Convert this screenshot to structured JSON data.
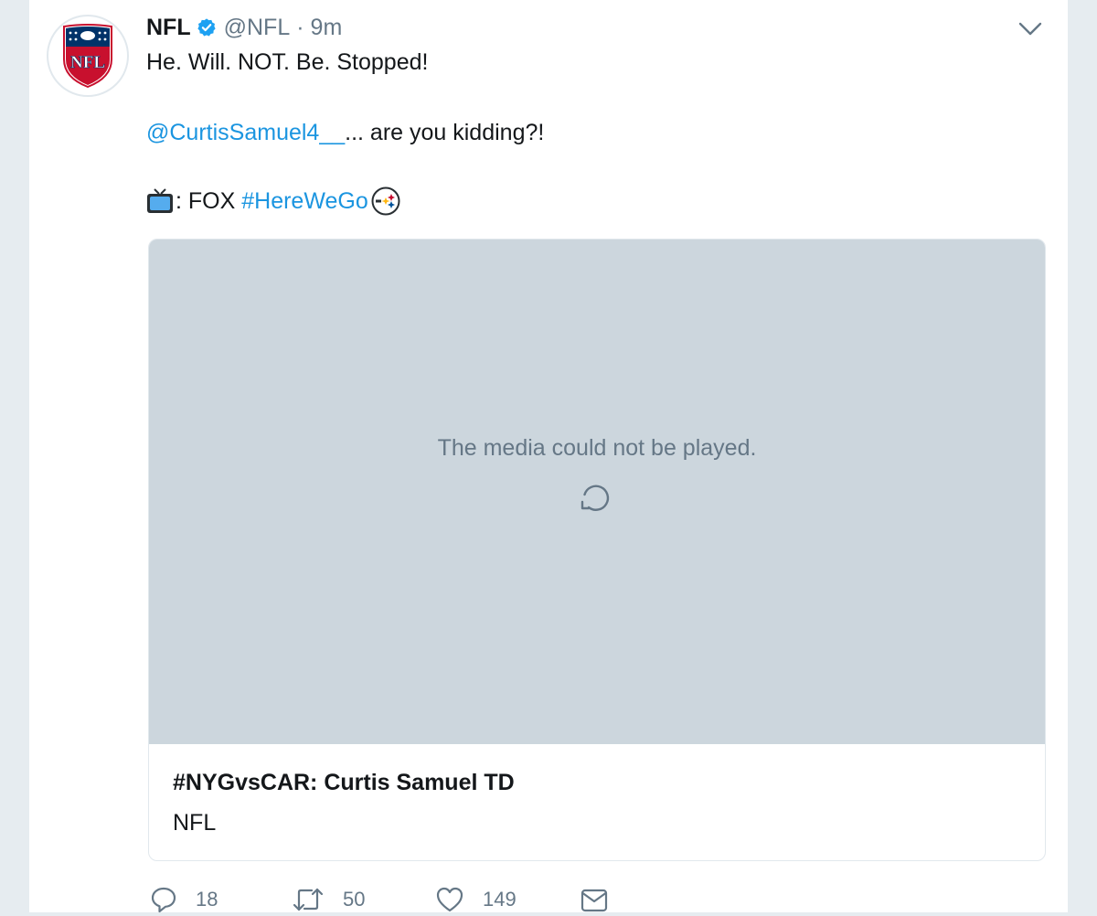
{
  "tweet": {
    "author_name": "NFL",
    "handle": "@NFL",
    "separator": "·",
    "timestamp": "9m",
    "verified_icon": "verified-badge-icon",
    "more_icon": "chevron-down-icon",
    "text": {
      "line1": "He. Will. NOT. Be. Stopped!",
      "mention": "@CurtisSamuel4__",
      "line2_rest": "... are you kidding?!",
      "tv_emoji": "television-emoji",
      "line3_prefix": ": FOX ",
      "hashtag": "#HereWeGo",
      "team_emoji": "steelers-logo-emoji"
    },
    "colors": {
      "link": "#1b95e0",
      "verified": "#1da1f2",
      "media_bg": "#ccd6dd",
      "muted": "#657786"
    }
  },
  "media_card": {
    "error_message": "The media could not be played.",
    "retry_icon": "retry-icon",
    "title": "#NYGvsCAR: Curtis Samuel TD",
    "source": "NFL"
  },
  "actions": {
    "reply": {
      "icon": "reply-icon",
      "count": "18"
    },
    "retweet": {
      "icon": "retweet-icon",
      "count": "50"
    },
    "like": {
      "icon": "heart-icon",
      "count": "149"
    },
    "message": {
      "icon": "envelope-icon"
    }
  }
}
